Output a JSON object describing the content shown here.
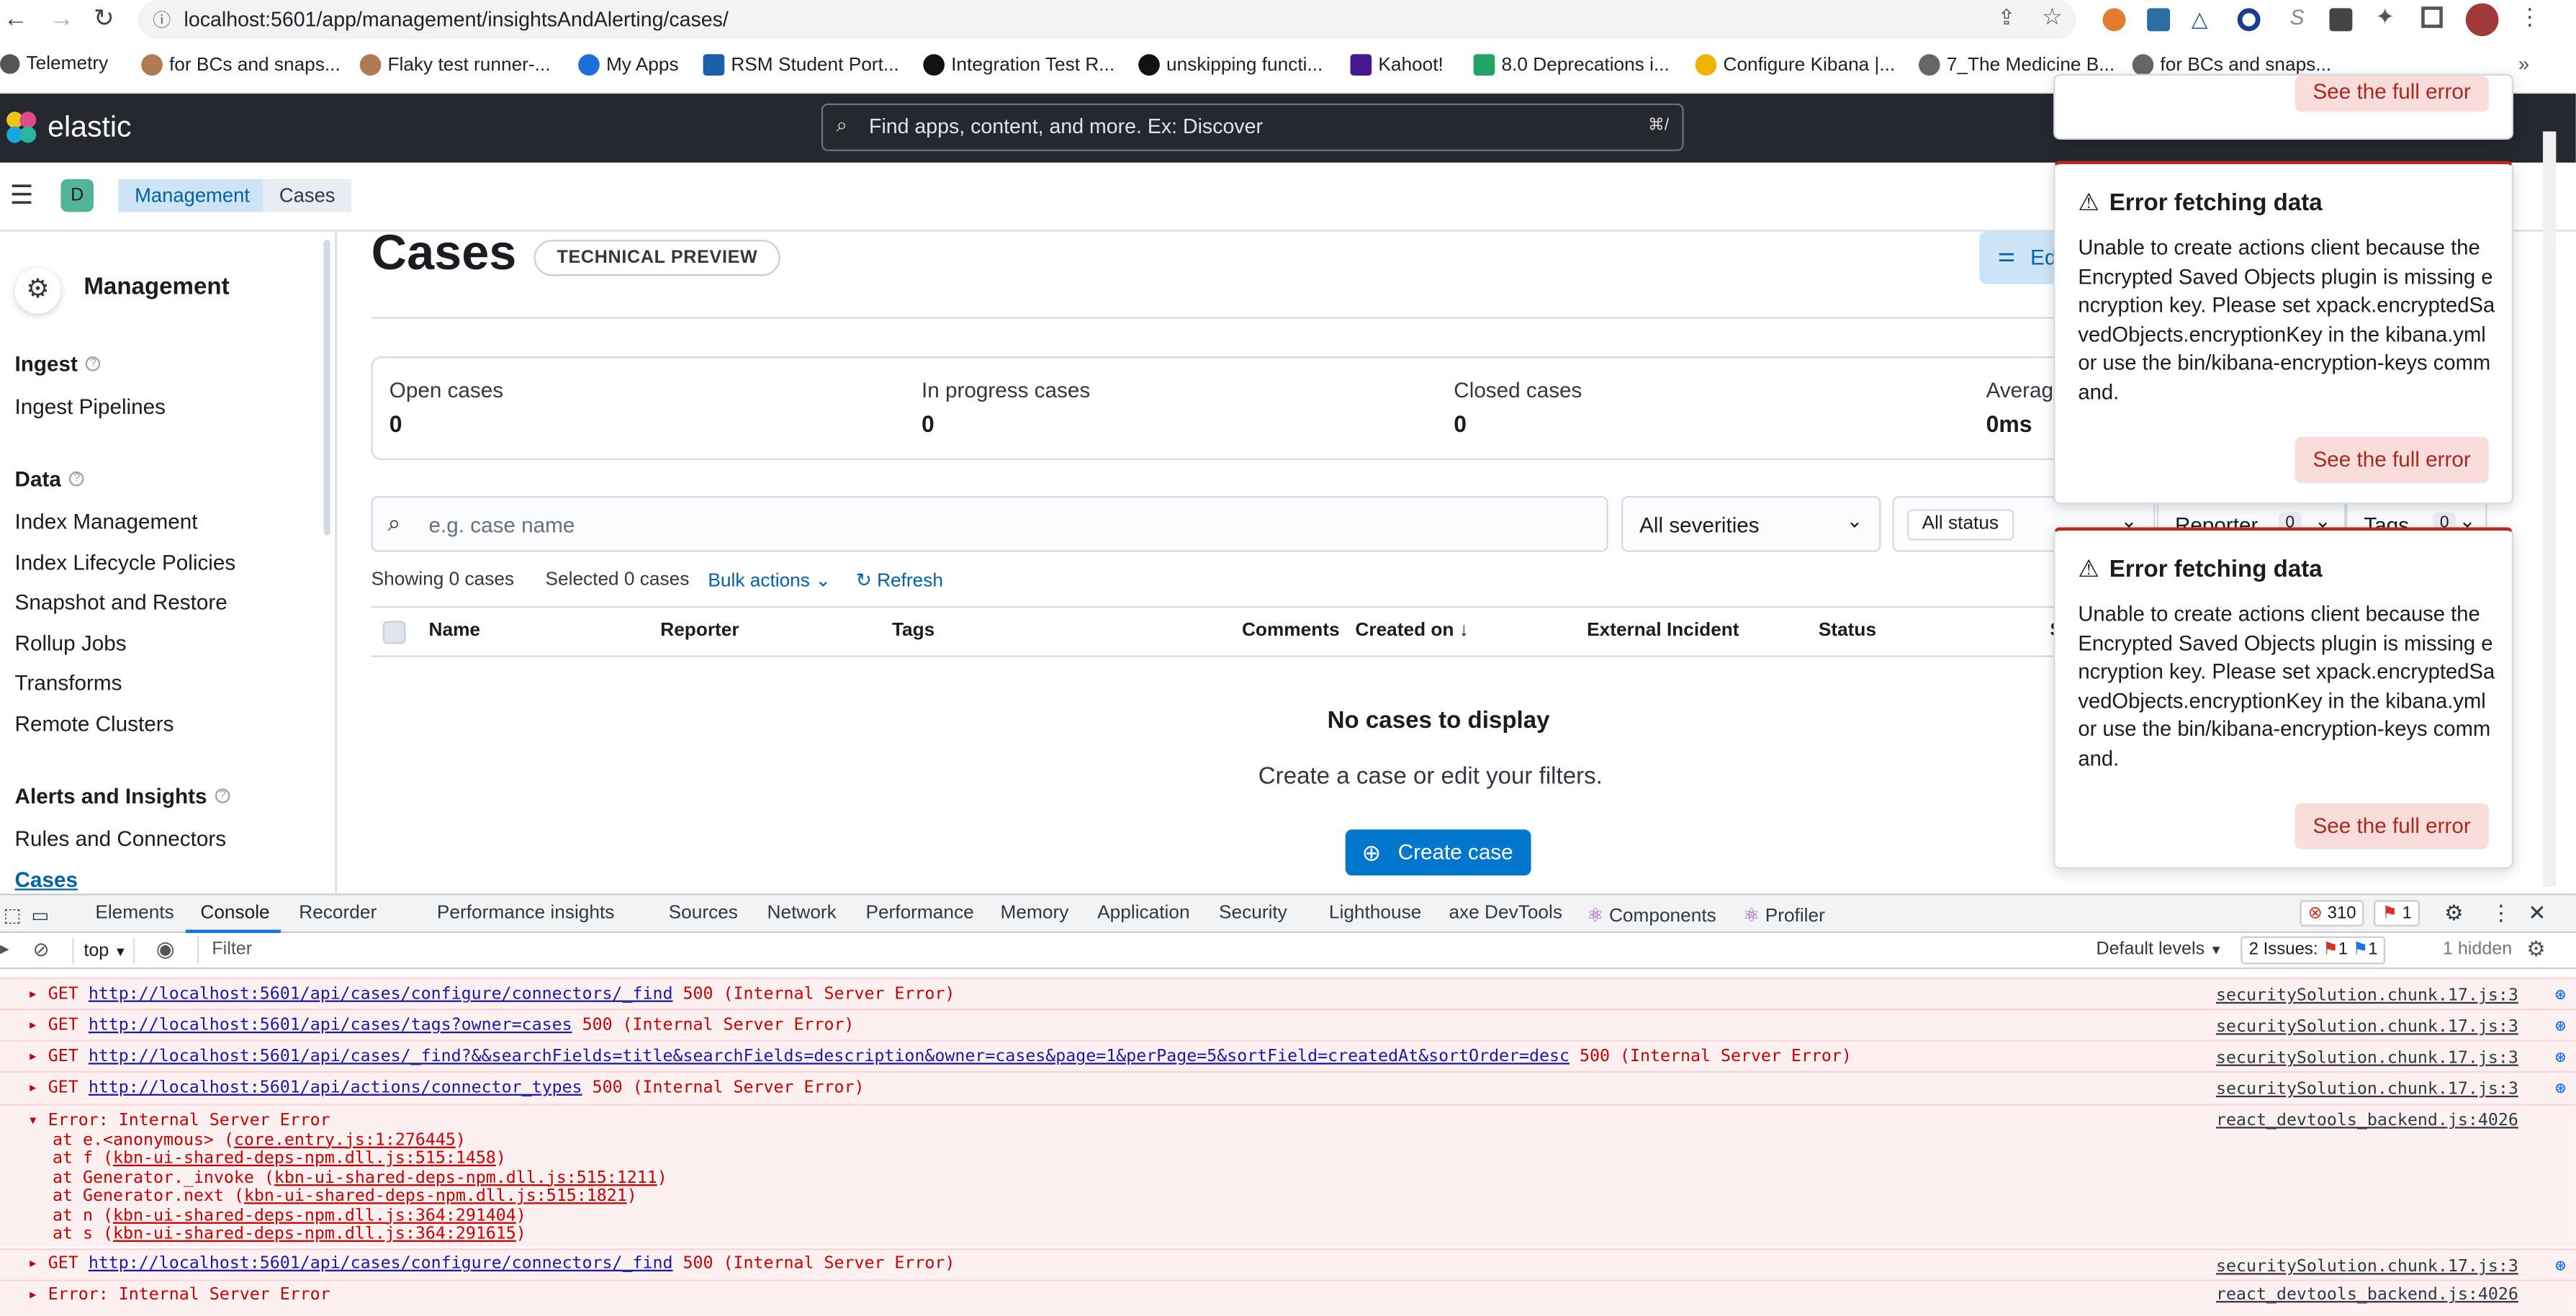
{
  "browser": {
    "url": "localhost:5601/app/management/insightsAndAlerting/cases/",
    "bookmarks": [
      {
        "label": "Telemetry",
        "color": "#555"
      },
      {
        "label": "for BCs and snaps...",
        "color": "#b07a55"
      },
      {
        "label": "Flaky test runner-...",
        "color": "#b07a55"
      },
      {
        "label": "My Apps",
        "color": "#1e6fd9"
      },
      {
        "label": "RSM Student Port...",
        "color": "#1a5faa"
      },
      {
        "label": "Integration Test R...",
        "color": "#111"
      },
      {
        "label": "unskipping functi...",
        "color": "#111"
      },
      {
        "label": "Kahoot!",
        "color": "#46178f"
      },
      {
        "label": "8.0 Deprecations i...",
        "color": "#21a464"
      },
      {
        "label": "Configure Kibana |...",
        "color": "#f0b400"
      },
      {
        "label": "7_The Medicine B...",
        "color": "#666"
      },
      {
        "label": "for BCs and snaps...",
        "color": "#666"
      }
    ]
  },
  "kibana": {
    "brand": "elastic",
    "search_placeholder": "Find apps, content, and more. Ex: Discover",
    "search_shortcut": "⌘/",
    "space_initial": "D",
    "breadcrumbs": [
      "Management",
      "Cases"
    ]
  },
  "sidebar": {
    "title": "Management",
    "groups": [
      {
        "heading": "Ingest",
        "items": [
          "Ingest Pipelines"
        ]
      },
      {
        "heading": "Data",
        "items": [
          "Index Management",
          "Index Lifecycle Policies",
          "Snapshot and Restore",
          "Rollup Jobs",
          "Transforms",
          "Remote Clusters"
        ]
      },
      {
        "heading": "Alerts and Insights",
        "items": [
          "Rules and Connectors",
          "Cases"
        ]
      }
    ]
  },
  "page": {
    "title": "Cases",
    "badge": "TECHNICAL PREVIEW",
    "edit_button": "Ed",
    "stats": [
      {
        "label": "Open cases",
        "value": "0"
      },
      {
        "label": "In progress cases",
        "value": "0"
      },
      {
        "label": "Closed cases",
        "value": "0"
      },
      {
        "label": "Averag",
        "value": "0ms"
      }
    ],
    "search_placeholder": "e.g. case name",
    "severity_filter": "All severities",
    "status_filter": "All status",
    "reporter_filter": "Reporter",
    "reporter_count": "0",
    "tags_filter": "Tags",
    "tags_count": "0",
    "showing": "Showing 0 cases",
    "selected": "Selected 0 cases",
    "bulk_actions": "Bulk actions",
    "refresh": "Refresh",
    "columns": [
      "Name",
      "Reporter",
      "Tags",
      "Comments",
      "Created on",
      "External Incident",
      "Status",
      "S"
    ],
    "empty_title": "No cases to display",
    "empty_subtitle": "Create a case or edit your filters.",
    "create_button": "Create case"
  },
  "toasts": [
    {
      "partial_button": "See the full error"
    },
    {
      "title": "Error fetching data",
      "body": "Unable to create actions client because the Encrypted Saved Objects plugin is missing encryption key. Please set xpack.encryptedSavedObjects.encryptionKey in the kibana.yml or use the bin/kibana-encryption-keys command.",
      "button": "See the full error"
    },
    {
      "title": "Error fetching data",
      "body": "Unable to create actions client because the Encrypted Saved Objects plugin is missing encryption key. Please set xpack.encryptedSavedObjects.encryptionKey in the kibana.yml or use the bin/kibana-encryption-keys command.",
      "button": "See the full error"
    }
  ],
  "devtools": {
    "tabs": [
      "Elements",
      "Console",
      "Recorder",
      "Performance insights",
      "Sources",
      "Network",
      "Performance",
      "Memory",
      "Application",
      "Security",
      "Lighthouse",
      "axe DevTools",
      "Components",
      "Profiler"
    ],
    "active_tab": "Console",
    "error_count": "310",
    "warn_count": "1",
    "context": "top",
    "filter_placeholder": "Filter",
    "levels": "Default levels",
    "issues_label": "2 Issues:",
    "issues_err": "1",
    "issues_info": "1",
    "hidden": "1 hidden",
    "logs": [
      {
        "method": "GET",
        "url": "http://localhost:5601/api/cases/configure/connectors/_find",
        "status": "500 (Internal Server Error)",
        "source": "securitySolution.chunk.17.js:3"
      },
      {
        "method": "GET",
        "url": "http://localhost:5601/api/cases/tags?owner=cases",
        "status": "500 (Internal Server Error)",
        "source": "securitySolution.chunk.17.js:3"
      },
      {
        "method": "GET",
        "url": "http://localhost:5601/api/cases/_find?&&searchFields=title&searchFields=description&owner=cases&page=1&perPage=5&sortField=createdAt&sortOrder=desc",
        "status": "500 (Internal Server Error)",
        "source": "securitySolution.chunk.17.js:3"
      },
      {
        "method": "GET",
        "url": "http://localhost:5601/api/actions/connector_types",
        "status": "500 (Internal Server Error)",
        "source": "securitySolution.chunk.17.js:3"
      }
    ],
    "stack": {
      "title": "Error: Internal Server Error",
      "source": "react_devtools_backend.js:4026",
      "frames": [
        {
          "pre": "at e.<anonymous> (",
          "link": "core.entry.js:1:276445",
          "post": ")"
        },
        {
          "pre": "at f (",
          "link": "kbn-ui-shared-deps-npm.dll.js:515:1458",
          "post": ")"
        },
        {
          "pre": "at Generator._invoke (",
          "link": "kbn-ui-shared-deps-npm.dll.js:515:1211",
          "post": ")"
        },
        {
          "pre": "at Generator.next (",
          "link": "kbn-ui-shared-deps-npm.dll.js:515:1821",
          "post": ")"
        },
        {
          "pre": "at n (",
          "link": "kbn-ui-shared-deps-npm.dll.js:364:291404",
          "post": ")"
        },
        {
          "pre": "at s (",
          "link": "kbn-ui-shared-deps-npm.dll.js:364:291615",
          "post": ")"
        }
      ]
    },
    "log_after": {
      "method": "GET",
      "url": "http://localhost:5601/api/cases/configure/connectors/_find",
      "status": "500 (Internal Server Error)",
      "source": "securitySolution.chunk.17.js:3"
    },
    "last_error": {
      "title": "Error: Internal Server Error",
      "source": "react_devtools_backend.js:4026"
    }
  }
}
